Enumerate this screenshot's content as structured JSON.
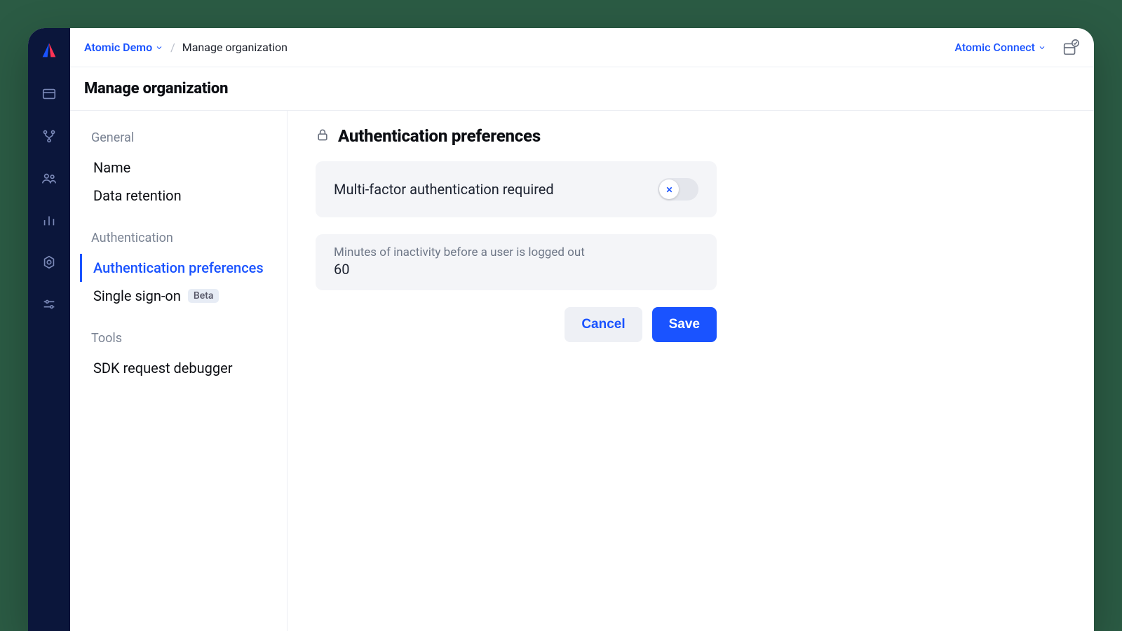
{
  "breadcrumbs": {
    "org": "Atomic Demo",
    "page": "Manage organization"
  },
  "topRight": {
    "environment": "Atomic Connect"
  },
  "pageTitle": "Manage organization",
  "settingsNav": {
    "sections": [
      {
        "label": "General",
        "items": [
          {
            "label": "Name",
            "active": false
          },
          {
            "label": "Data retention",
            "active": false
          }
        ]
      },
      {
        "label": "Authentication",
        "items": [
          {
            "label": "Authentication preferences",
            "active": true
          },
          {
            "label": "Single sign-on",
            "active": false,
            "badge": "Beta"
          }
        ]
      },
      {
        "label": "Tools",
        "items": [
          {
            "label": "SDK request debugger",
            "active": false
          }
        ]
      }
    ]
  },
  "content": {
    "heading": "Authentication preferences",
    "mfa": {
      "label": "Multi-factor authentication required",
      "enabled": false
    },
    "timeout": {
      "label": "Minutes of inactivity before a user is logged out",
      "value": "60"
    },
    "buttons": {
      "cancel": "Cancel",
      "save": "Save"
    }
  }
}
